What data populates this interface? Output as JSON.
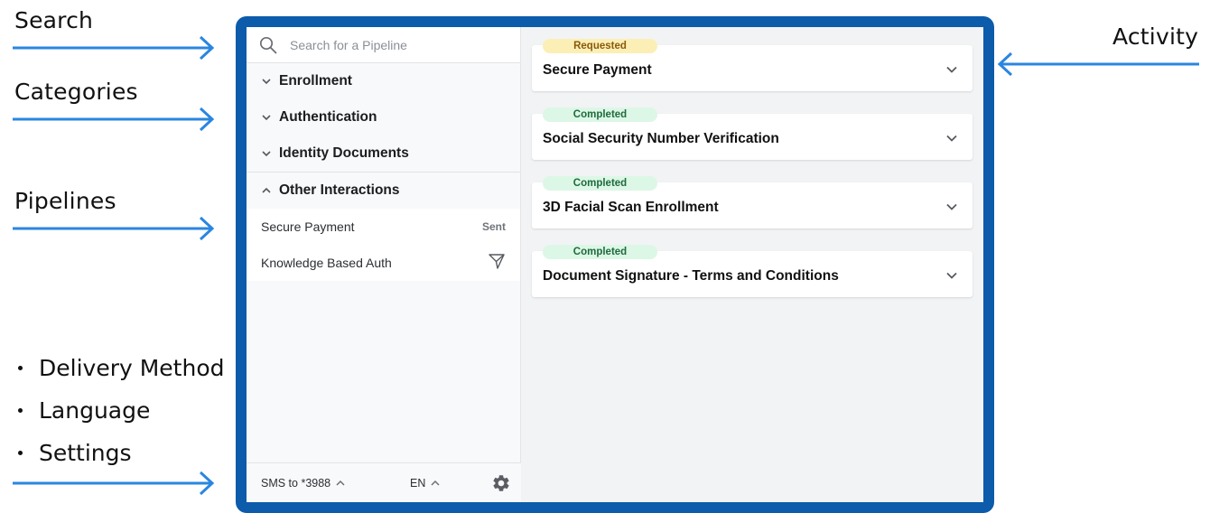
{
  "annotations": {
    "search": "Search",
    "categories": "Categories",
    "pipelines": "Pipelines",
    "activity": "Activity",
    "bullets": [
      "Delivery Method",
      "Language",
      "Settings"
    ]
  },
  "search": {
    "placeholder": "Search for a Pipeline",
    "icon": "search-icon"
  },
  "categories": [
    {
      "label": "Enrollment",
      "expanded": false
    },
    {
      "label": "Authentication",
      "expanded": false
    },
    {
      "label": "Identity Documents",
      "expanded": false
    },
    {
      "label": "Other Interactions",
      "expanded": true
    }
  ],
  "pipelines": [
    {
      "name": "Secure Payment",
      "status": "Sent"
    },
    {
      "name": "Knowledge Based Auth",
      "status_icon": "send-icon"
    }
  ],
  "footer": {
    "delivery": "SMS to *3988",
    "language": "EN",
    "settings_icon": "gear-icon"
  },
  "activity": [
    {
      "status": "Requested",
      "title": "Secure Payment"
    },
    {
      "status": "Completed",
      "title": "Social Security Number Verification"
    },
    {
      "status": "Completed",
      "title": "3D Facial Scan Enrollment"
    },
    {
      "status": "Completed",
      "title": "Document Signature - Terms and Conditions"
    }
  ],
  "colors": {
    "frame": "#0d5bab",
    "arrow": "#2a86e0",
    "requested_bg": "#fcefb6",
    "requested_text": "#8a5a0a",
    "completed_bg": "#dcf7e6",
    "completed_text": "#1e6b3d"
  }
}
